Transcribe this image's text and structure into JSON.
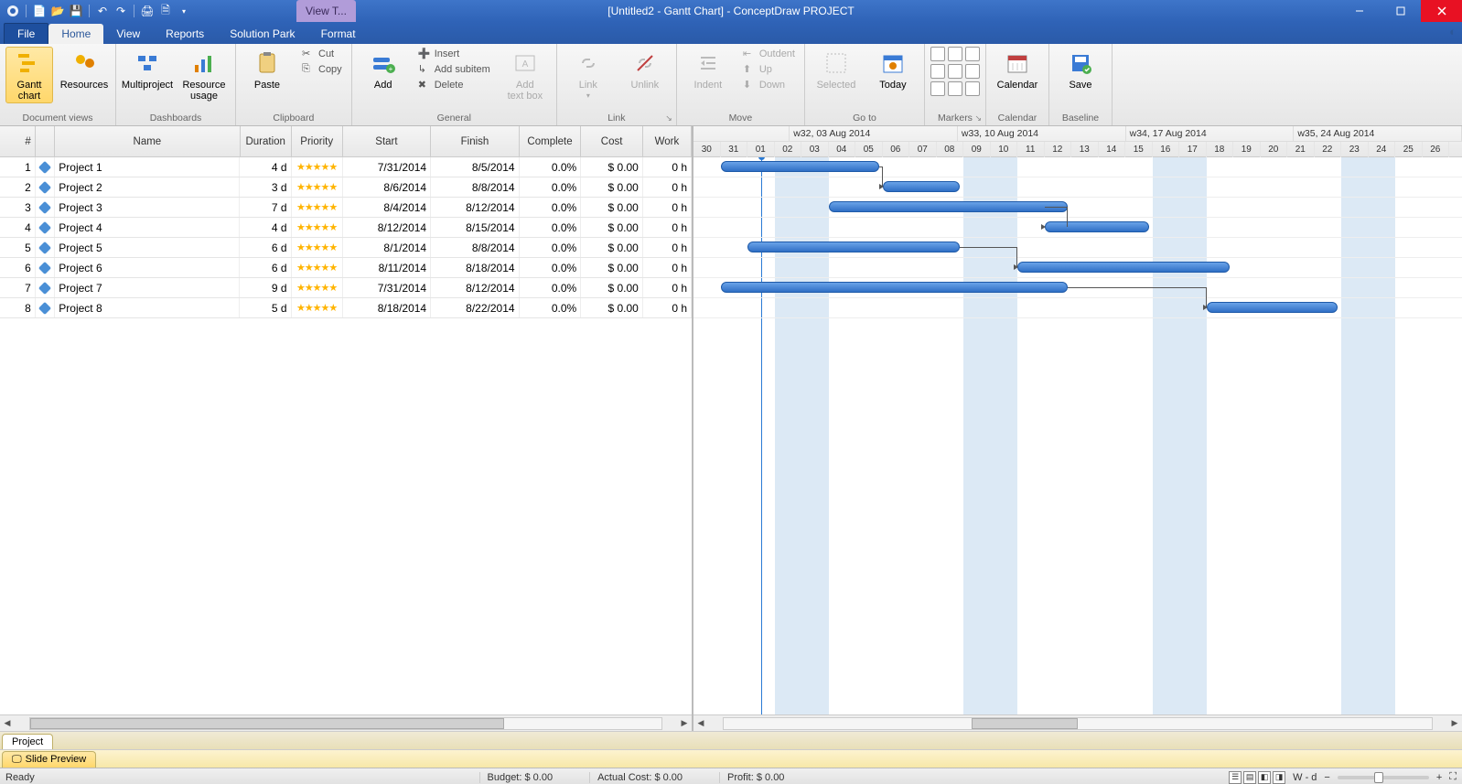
{
  "window": {
    "title": "[Untitled2 - Gantt Chart] - ConceptDraw PROJECT",
    "extra_tab": "View T..."
  },
  "tabs": {
    "file": "File",
    "items": [
      "Home",
      "View",
      "Reports",
      "Solution Park",
      "Format"
    ],
    "active_index": 0
  },
  "ribbon": {
    "groups": [
      {
        "label": "Document views",
        "items": [
          {
            "big": true,
            "active": true,
            "label": "Gantt chart",
            "icon": "gantt-icon"
          },
          {
            "big": true,
            "label": "Resources",
            "icon": "resources-icon"
          }
        ]
      },
      {
        "label": "Dashboards",
        "items": [
          {
            "big": true,
            "label": "Multiproject",
            "icon": "multiproject-icon"
          },
          {
            "big": true,
            "label": "Resource usage",
            "icon": "resource-usage-icon"
          }
        ]
      },
      {
        "label": "Clipboard",
        "items": [
          {
            "big": true,
            "label": "Paste",
            "icon": "paste-icon"
          },
          {
            "small": [
              "Cut",
              "Copy"
            ],
            "icons": [
              "cut-icon",
              "copy-icon"
            ]
          }
        ]
      },
      {
        "label": "General",
        "items": [
          {
            "big": true,
            "label": "Add",
            "icon": "add-icon"
          },
          {
            "small": [
              "Insert",
              "Add subitem",
              "Delete"
            ],
            "icons": [
              "insert-icon",
              "subitem-icon",
              "delete-icon"
            ]
          },
          {
            "big": true,
            "label": "Add text box",
            "icon": "textbox-icon",
            "disabled": true
          }
        ]
      },
      {
        "label": "Link",
        "items": [
          {
            "big": true,
            "label": "Link",
            "icon": "link-icon",
            "disabled": true,
            "dropdown": true
          },
          {
            "big": true,
            "label": "Unlink",
            "icon": "unlink-icon",
            "disabled": true
          }
        ]
      },
      {
        "label": "Move",
        "items": [
          {
            "big": true,
            "label": "Indent",
            "icon": "indent-icon",
            "disabled": true
          },
          {
            "small": [
              "Outdent",
              "Up",
              "Down"
            ],
            "icons": [
              "outdent-icon",
              "up-icon",
              "down-icon"
            ],
            "disabled": true
          }
        ]
      },
      {
        "label": "Go to",
        "items": [
          {
            "big": true,
            "label": "Selected",
            "icon": "selected-icon",
            "disabled": true
          },
          {
            "big": true,
            "label": "Today",
            "icon": "today-icon"
          }
        ]
      },
      {
        "label": "Markers",
        "items": [
          {
            "markers": true
          }
        ]
      },
      {
        "label": "Calendar",
        "items": [
          {
            "big": true,
            "label": "Calendar",
            "icon": "calendar-icon"
          }
        ]
      },
      {
        "label": "Baseline",
        "items": [
          {
            "big": true,
            "label": "Save",
            "icon": "save-baseline-icon"
          }
        ]
      }
    ]
  },
  "table": {
    "columns": [
      "#",
      "",
      "Name",
      "Duration",
      "Priority",
      "Start",
      "Finish",
      "Complete",
      "Cost",
      "Work"
    ],
    "rows": [
      {
        "n": 1,
        "name": "Project 1",
        "dur": "4 d",
        "start": "7/31/2014",
        "fin": "8/5/2014",
        "comp": "0.0%",
        "cost": "$ 0.00",
        "work": "0 h",
        "bar_start": 1,
        "bar_len": 6
      },
      {
        "n": 2,
        "name": "Project 2",
        "dur": "3 d",
        "start": "8/6/2014",
        "fin": "8/8/2014",
        "comp": "0.0%",
        "cost": "$ 0.00",
        "work": "0 h",
        "bar_start": 7,
        "bar_len": 3
      },
      {
        "n": 3,
        "name": "Project 3",
        "dur": "7 d",
        "start": "8/4/2014",
        "fin": "8/12/2014",
        "comp": "0.0%",
        "cost": "$ 0.00",
        "work": "0 h",
        "bar_start": 5,
        "bar_len": 9
      },
      {
        "n": 4,
        "name": "Project 4",
        "dur": "4 d",
        "start": "8/12/2014",
        "fin": "8/15/2014",
        "comp": "0.0%",
        "cost": "$ 0.00",
        "work": "0 h",
        "bar_start": 13,
        "bar_len": 4
      },
      {
        "n": 5,
        "name": "Project 5",
        "dur": "6 d",
        "start": "8/1/2014",
        "fin": "8/8/2014",
        "comp": "0.0%",
        "cost": "$ 0.00",
        "work": "0 h",
        "bar_start": 2,
        "bar_len": 8
      },
      {
        "n": 6,
        "name": "Project 6",
        "dur": "6 d",
        "start": "8/11/2014",
        "fin": "8/18/2014",
        "comp": "0.0%",
        "cost": "$ 0.00",
        "work": "0 h",
        "bar_start": 12,
        "bar_len": 8
      },
      {
        "n": 7,
        "name": "Project 7",
        "dur": "9 d",
        "start": "7/31/2014",
        "fin": "8/12/2014",
        "comp": "0.0%",
        "cost": "$ 0.00",
        "work": "0 h",
        "bar_start": 1,
        "bar_len": 13
      },
      {
        "n": 8,
        "name": "Project 8",
        "dur": "5 d",
        "start": "8/18/2014",
        "fin": "8/22/2014",
        "comp": "0.0%",
        "cost": "$ 0.00",
        "work": "0 h",
        "bar_start": 19,
        "bar_len": 5
      }
    ]
  },
  "timeline": {
    "weeks": [
      "w32, 03 Aug 2014",
      "w33, 10 Aug 2014",
      "w34, 17 Aug 2014",
      "w35, 24 Aug 2014"
    ],
    "start_day": 30,
    "days": [
      "30",
      "31",
      "01",
      "02",
      "03",
      "04",
      "05",
      "06",
      "07",
      "08",
      "09",
      "10",
      "11",
      "12",
      "13",
      "14",
      "15",
      "16",
      "17",
      "18",
      "19",
      "20",
      "21",
      "22",
      "23",
      "24",
      "25",
      "26"
    ],
    "day_width": 29.5,
    "weekend_indices_pairs": [
      [
        3,
        4
      ],
      [
        10,
        11
      ],
      [
        17,
        18
      ],
      [
        24,
        25
      ]
    ],
    "today_index": 2
  },
  "sheet_tabs": {
    "project": "Project",
    "preview": "Slide Preview"
  },
  "status": {
    "ready": "Ready",
    "budget_label": "Budget:",
    "budget_val": "$ 0.00",
    "actual_label": "Actual Cost:",
    "actual_val": "$ 0.00",
    "profit_label": "Profit:",
    "profit_val": "$ 0.00",
    "zoom_label": "W - d"
  },
  "chart_data": {
    "type": "gantt",
    "title": "Gantt Chart",
    "x_unit": "date",
    "x_range": [
      "2014-07-30",
      "2014-08-26"
    ],
    "series": [
      {
        "name": "Project 1",
        "start": "2014-07-31",
        "end": "2014-08-05",
        "duration_days": 4
      },
      {
        "name": "Project 2",
        "start": "2014-08-06",
        "end": "2014-08-08",
        "duration_days": 3
      },
      {
        "name": "Project 3",
        "start": "2014-08-04",
        "end": "2014-08-12",
        "duration_days": 7
      },
      {
        "name": "Project 4",
        "start": "2014-08-12",
        "end": "2014-08-15",
        "duration_days": 4
      },
      {
        "name": "Project 5",
        "start": "2014-08-01",
        "end": "2014-08-08",
        "duration_days": 6
      },
      {
        "name": "Project 6",
        "start": "2014-08-11",
        "end": "2014-08-18",
        "duration_days": 6
      },
      {
        "name": "Project 7",
        "start": "2014-07-31",
        "end": "2014-08-12",
        "duration_days": 9
      },
      {
        "name": "Project 8",
        "start": "2014-08-18",
        "end": "2014-08-22",
        "duration_days": 5
      }
    ],
    "dependencies": [
      {
        "from": "Project 1",
        "to": "Project 2"
      },
      {
        "from": "Project 3",
        "to": "Project 4"
      },
      {
        "from": "Project 5",
        "to": "Project 6"
      },
      {
        "from": "Project 7",
        "to": "Project 8"
      }
    ]
  }
}
